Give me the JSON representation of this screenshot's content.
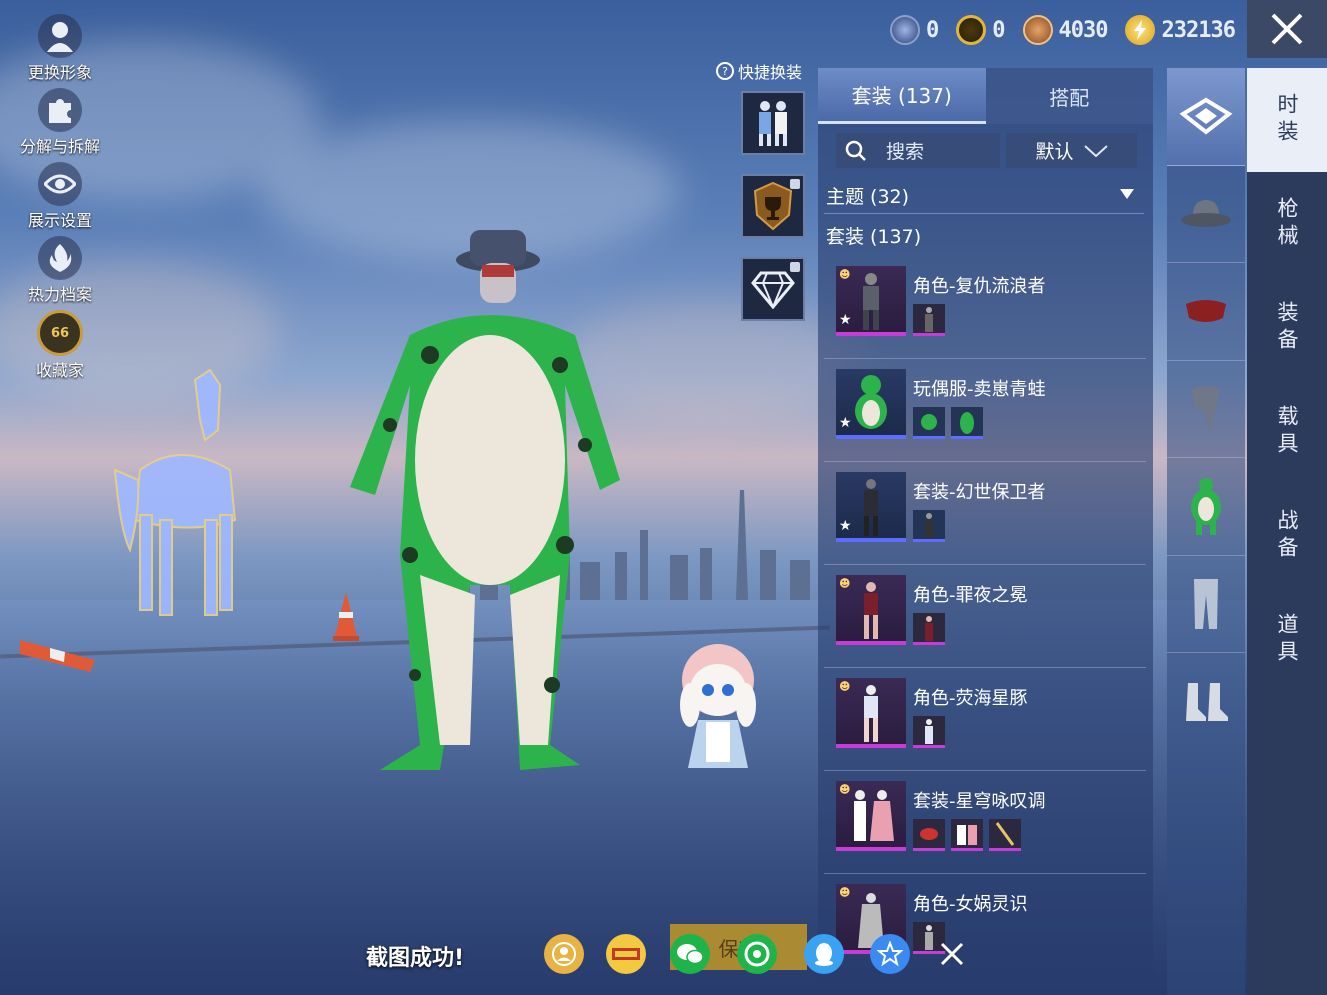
{
  "left_menu": [
    {
      "label": "更换形象",
      "icon": "avatar-icon"
    },
    {
      "label": "分解与拆解",
      "icon": "puzzle-icon"
    },
    {
      "label": "展示设置",
      "icon": "eye-icon"
    },
    {
      "label": "热力档案",
      "icon": "flame-icon"
    },
    {
      "label": "收藏家",
      "icon": "collector-badge-icon",
      "badge_value": "66"
    }
  ],
  "currencies": [
    {
      "icon": "globe-coin-icon",
      "value": "0"
    },
    {
      "icon": "gold-emblem-coin-icon",
      "value": "0"
    },
    {
      "icon": "bronze-coin-icon",
      "value": "4030"
    },
    {
      "icon": "lightning-coin-icon",
      "value": "232136"
    }
  ],
  "quick_swap": {
    "label": "快捷换装",
    "help": "?"
  },
  "panel": {
    "tabs": [
      {
        "label": "套装 (137)",
        "active": true
      },
      {
        "label": "搭配",
        "active": false
      }
    ],
    "search_placeholder": "搜索",
    "sort_label": "默认",
    "filter_label": "主题 (32)",
    "category_label": "套装 (137)",
    "items": [
      {
        "name": "角色-复仇流浪者",
        "starred": true,
        "minis": 1
      },
      {
        "name": "玩偶服-卖崽青蛙",
        "starred": true,
        "minis": 2
      },
      {
        "name": "套装-幻世保卫者",
        "starred": true,
        "minis": 1
      },
      {
        "name": "角色-罪夜之冕",
        "starred": false,
        "minis": 1
      },
      {
        "name": "角色-荧海星豚",
        "starred": false,
        "minis": 1
      },
      {
        "name": "套装-星穹咏叹调",
        "starred": false,
        "minis": 3
      },
      {
        "name": "角色-女娲灵识",
        "starred": false,
        "minis": 1
      }
    ]
  },
  "category_icons": [
    "outfit-box-icon",
    "hat-icon",
    "mask-icon",
    "scarf-icon",
    "frog-suit-icon",
    "pants-icon",
    "boots-icon"
  ],
  "right_tabs": [
    "时装",
    "枪械",
    "装备",
    "载具",
    "战备",
    "道具"
  ],
  "bottom": {
    "screenshot_text": "截图成功!",
    "save_label": "保存",
    "share_icons": [
      "profile-share-icon",
      "game-logo-icon",
      "wechat-icon",
      "moments-icon",
      "qq-icon",
      "qzone-icon",
      "close-icon"
    ]
  }
}
